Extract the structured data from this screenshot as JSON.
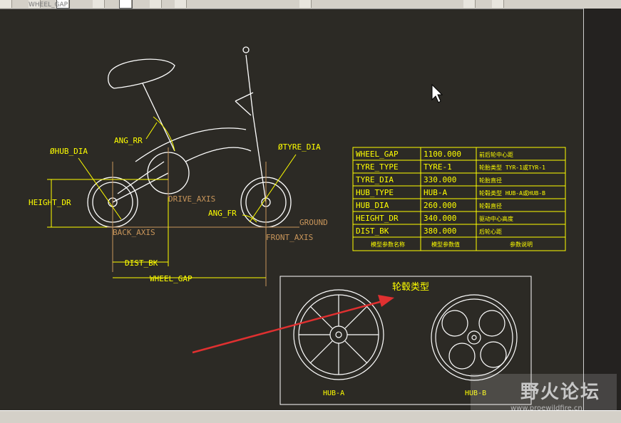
{
  "toolbar": {
    "label": "WHEEL_GAP",
    "buttons": [
      "new-icon",
      "open-icon",
      "save-icon",
      "cut-icon",
      "copy-icon",
      "undo-icon",
      "redo-icon",
      "refresh-icon",
      "print-icon",
      "zoom-icon"
    ]
  },
  "drawing": {
    "dims": {
      "hub_dia": "ØHUB_DIA",
      "ang_rr": "ANG_RR",
      "tyre_dia": "ØTYRE_DIA",
      "height_dr": "HEIGHT_DR",
      "drive_axis": "DRIVE_AXIS",
      "ang_fr": "ANG_FR",
      "ground": "GROUND",
      "back_axis": "BACK_AXIS",
      "front_axis": "FRONT_AXIS",
      "dist_bk": "DIST_BK",
      "wheel_gap": "WHEEL_GAP"
    }
  },
  "param_table": {
    "rows": [
      {
        "name": "WHEEL_GAP",
        "value": "1100.000",
        "desc": "前后轮中心距"
      },
      {
        "name": "TYRE_TYPE",
        "value": "TYRE-1",
        "desc": "轮胎类型  TYR-1或TYR-1"
      },
      {
        "name": "TYRE_DIA",
        "value": "330.000",
        "desc": "轮胎直径"
      },
      {
        "name": "HUB_TYPE",
        "value": "HUB-A",
        "desc": "轮毂类型  HUB-A或HUB-B"
      },
      {
        "name": "HUB_DIA",
        "value": "260.000",
        "desc": "轮毂直径"
      },
      {
        "name": "HEIGHT_DR",
        "value": "340.000",
        "desc": "驱动中心高度"
      },
      {
        "name": "DIST_BK",
        "value": "380.000",
        "desc": "后轮心距"
      }
    ],
    "footer": [
      "模型参数名称",
      "模型参数值",
      "参数说明"
    ]
  },
  "hub_panel": {
    "title": "轮毂类型",
    "hub_a": "HUB-A",
    "hub_b": "HUB-B"
  },
  "watermark": {
    "title": "野火论坛",
    "url": "www.proewildfire.cn"
  },
  "colors": {
    "background": "#2c2a25",
    "lines": "#ffffff",
    "dimension": "#ffff00",
    "axis": "#c8955a",
    "arrow": "#e03030"
  }
}
